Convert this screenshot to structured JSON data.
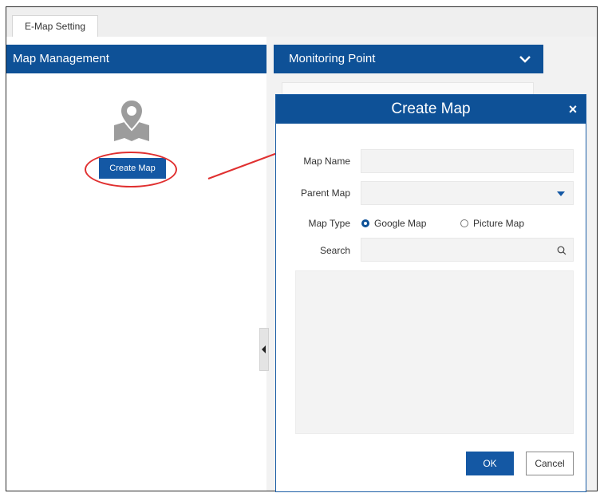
{
  "tabs": [
    {
      "label": "E-Map Setting"
    }
  ],
  "map_management": {
    "title": "Map Management",
    "create_button": "Create Map",
    "icon": "map-pin-icon"
  },
  "monitoring_point": {
    "title": "Monitoring Point",
    "toggle_icon": "chevron-down-icon"
  },
  "create_map_dialog": {
    "title": "Create Map",
    "close_label": "×",
    "map_name": {
      "label": "Map Name",
      "value": ""
    },
    "parent_map": {
      "label": "Parent Map",
      "value": ""
    },
    "map_type": {
      "label": "Map Type",
      "options": [
        {
          "label": "Google Map",
          "selected": true
        },
        {
          "label": "Picture Map",
          "selected": false
        }
      ]
    },
    "search": {
      "label": "Search",
      "value": ""
    },
    "ok_label": "OK",
    "cancel_label": "Cancel"
  },
  "colors": {
    "header_blue": "#0e5197",
    "button_blue": "#1458a4",
    "annotation_red": "#e03030"
  }
}
